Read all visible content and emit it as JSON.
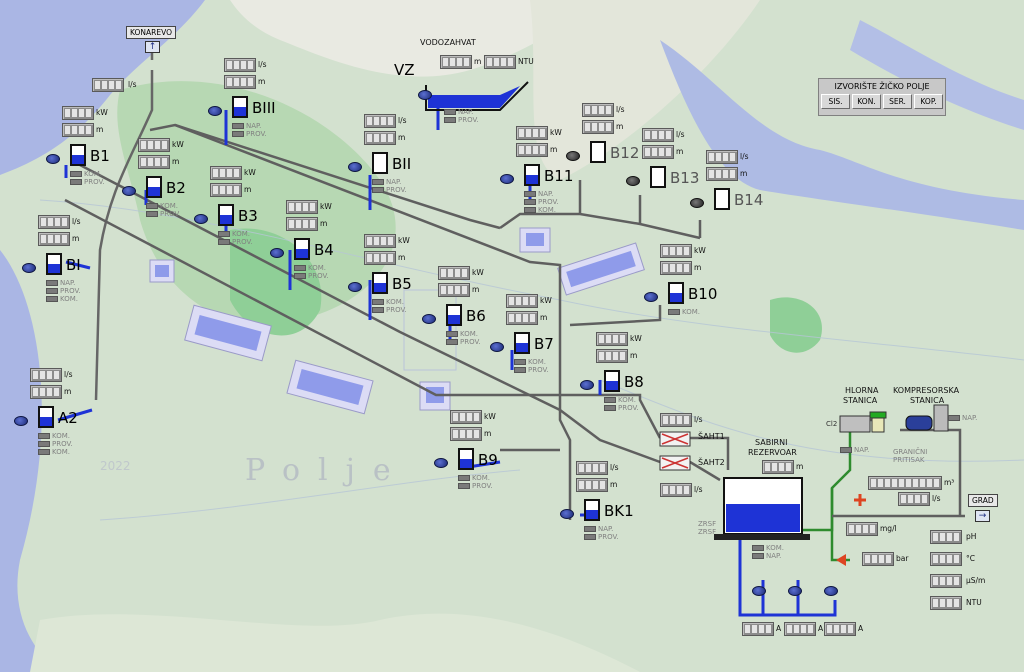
{
  "header": {
    "field_title": "IZVORIŠTE ŽIČKO POLJE",
    "buttons": [
      "SIS.",
      "KON.",
      "SER.",
      "KOP."
    ]
  },
  "labels": {
    "konarevo": "KONAREVO",
    "vodozahvat": "VODOZAHVAT",
    "vz": "VZ",
    "ntu": "NTU",
    "sabirni1": "SABIRNI",
    "sabirni2": "REZERVOAR",
    "hlorna1": "HLORNA",
    "hlorna2": "STANICA",
    "kompr1": "KOMPRESORSKA",
    "kompr2": "STANICA",
    "granicni1": "GRANIČNI",
    "granicni2": "PRITISAK",
    "grad": "GRAD",
    "saht1": "ŠAHT1",
    "saht2": "ŠAHT2",
    "zrsf1": "ZRSF",
    "zrsf2": "ZRSF",
    "cl2": "Cl2",
    "map_text": "Polje"
  },
  "units": {
    "ls": "l/s",
    "m": "m",
    "kw": "kW",
    "m3": "m³",
    "mgl": "mg/l",
    "bar": "bar",
    "ph": "pH",
    "c": "°C",
    "uscm": "µS/m",
    "ntu": "NTU",
    "a": "A"
  },
  "status": {
    "nap": "NAP.",
    "prov": "PROV.",
    "kom": "KOM."
  },
  "wells": [
    {
      "name": "B1"
    },
    {
      "name": "B2"
    },
    {
      "name": "B3"
    },
    {
      "name": "B4"
    },
    {
      "name": "B5"
    },
    {
      "name": "B6"
    },
    {
      "name": "B7"
    },
    {
      "name": "B8"
    },
    {
      "name": "B9"
    },
    {
      "name": "B10"
    },
    {
      "name": "B11"
    },
    {
      "name": "B12"
    },
    {
      "name": "B13"
    },
    {
      "name": "B14"
    },
    {
      "name": "BI"
    },
    {
      "name": "A2"
    },
    {
      "name": "BII"
    },
    {
      "name": "BIII"
    },
    {
      "name": "BK1"
    }
  ],
  "colors": {
    "water": "#1e33d6",
    "pipe": "#555555",
    "map_river": "#a9b6e6",
    "map_land": "#d6e4d2",
    "map_green": "#8fcf97"
  }
}
